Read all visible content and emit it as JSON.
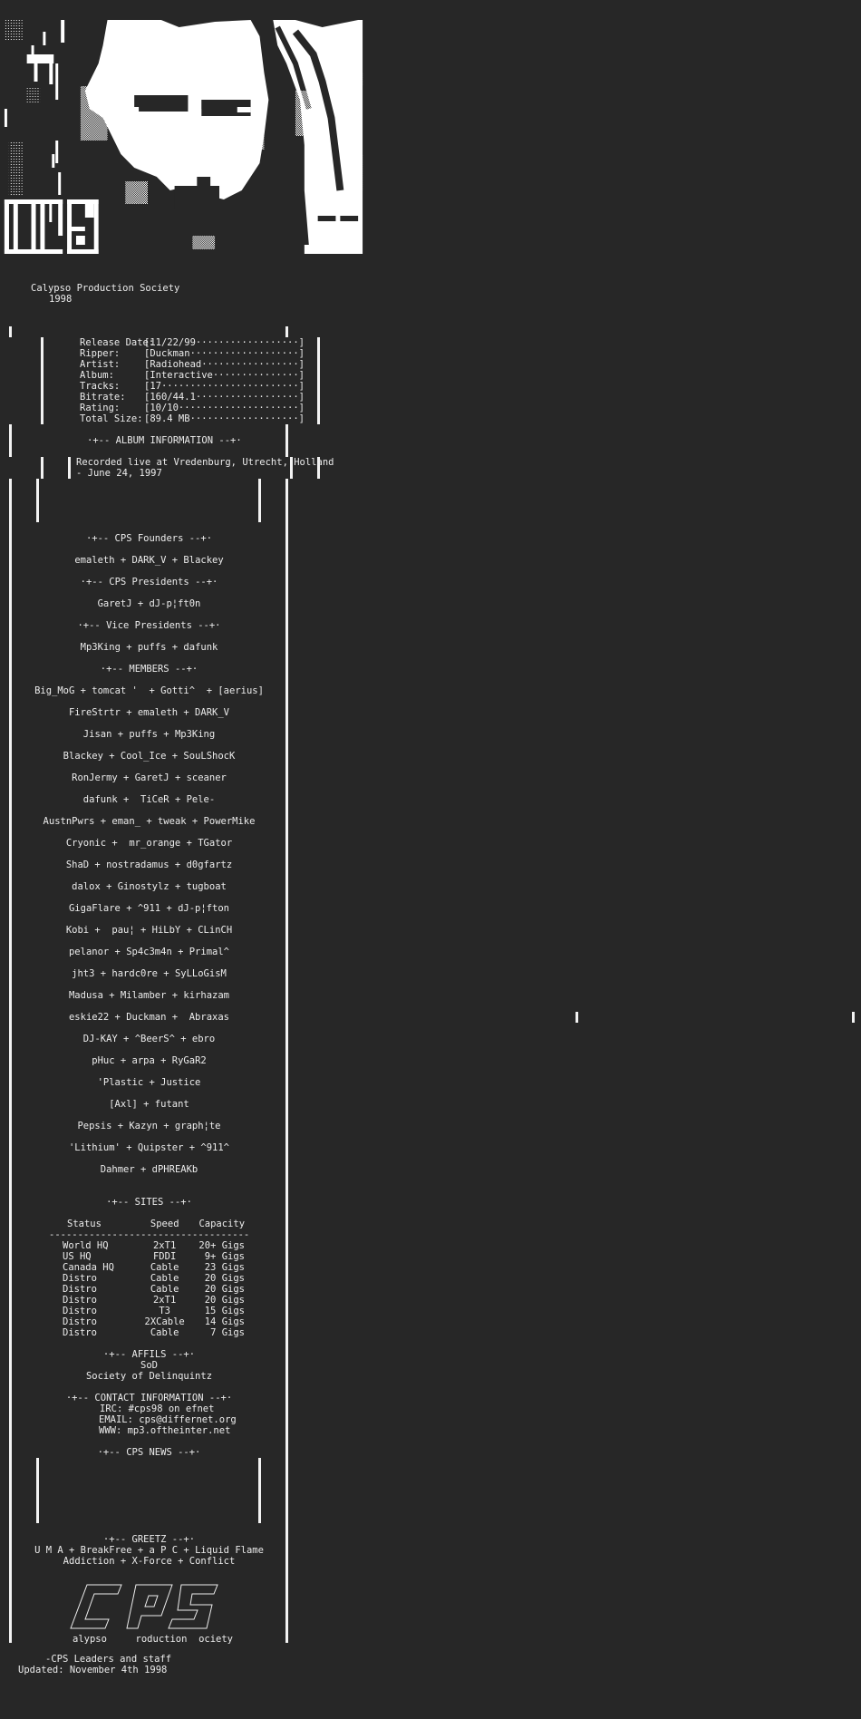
{
  "header": {
    "group_name": "Calypso Production Society",
    "year": "1998",
    "art_description": "ANSI/ASCII art portrait with CPS block logo"
  },
  "release": {
    "fields": [
      {
        "label": "Release Date:",
        "value": "[11/22/99··················]"
      },
      {
        "label": "Ripper:",
        "value": "[Duckman···················]"
      },
      {
        "label": "Artist:",
        "value": "[Radiohead·················]"
      },
      {
        "label": "Album:",
        "value": "[Interactive···············]"
      },
      {
        "label": "Tracks:",
        "value": "[17························]"
      },
      {
        "label": "Bitrate:",
        "value": "[160/44.1··················]"
      },
      {
        "label": "Rating:",
        "value": "[10/10·····················]"
      },
      {
        "label": "Total Size:",
        "value": "[89.4 MB···················]"
      }
    ]
  },
  "album_info": {
    "heading": "·+-- ALBUM INFORMATION --+·",
    "text_line1": "Recorded live at Vredenburg, Utrecht, Holland",
    "text_line2": "- June 24, 1997"
  },
  "founders": {
    "heading": "·+-- CPS Founders --+·",
    "names": "emaleth + DARK_V + Blackey"
  },
  "presidents": {
    "heading": "·+-- CPS Presidents --+·",
    "names": "GaretJ + dJ-p¦ft0n"
  },
  "vice_presidents": {
    "heading": "·+-- Vice Presidents --+·",
    "names": "Mp3King + puffs + dafunk"
  },
  "members": {
    "heading": "·+-- MEMBERS --+·",
    "lines": [
      "Big_MoG + tomcat '  + Gotti^  + [aerius]",
      "FireStrtr + emaleth + DARK_V",
      "Jisan + puffs + Mp3King",
      "Blackey + Cool_Ice + SouLShocK",
      "RonJermy + GaretJ + sceaner",
      "dafunk +  TiCeR + Pele-",
      "AustnPwrs + eman_ + tweak + PowerMike",
      "Cryonic +  mr_orange + TGator",
      "ShaD + nostradamus + d0gfartz",
      "dalox + Ginostylz + tugboat",
      "GigaFlare + ^911 + dJ-p¦fton",
      "Kobi +  pau¦ + HiLbY + CLinCH",
      "pelanor + Sp4c3m4n + Primal^",
      "jht3 + hardc0re + SyLLoGisM",
      "Madusa + Milamber + kirhazam",
      "eskie22 + Duckman +  Abraxas",
      "DJ-KAY + ^BeerS^ + ebro",
      "pHuc + arpa + RyGaR2",
      "'Plastic + Justice",
      "[Axl] + futant",
      "Pepsis + Kazyn + graph¦te",
      "'Lithium' + Quipster + ^911^",
      "Dahmer + dPHREAKb"
    ]
  },
  "sites": {
    "heading": "·+-- SITES --+·",
    "columns": [
      "Status",
      "Speed",
      "Capacity"
    ],
    "rule": "--------------------------------------------",
    "rows": [
      [
        "World HQ",
        "2xT1",
        "20+ Gigs"
      ],
      [
        "US HQ",
        "FDDI",
        "9+ Gigs"
      ],
      [
        "Canada HQ",
        "Cable",
        "23 Gigs"
      ],
      [
        "Distro",
        "Cable",
        "20 Gigs"
      ],
      [
        "Distro",
        "Cable",
        "20 Gigs"
      ],
      [
        "Distro",
        "2xT1",
        "20 Gigs"
      ],
      [
        "Distro",
        "T3",
        "15 Gigs"
      ],
      [
        "Distro",
        "2XCable",
        "14 Gigs"
      ],
      [
        "Distro",
        "Cable",
        "7 Gigs"
      ]
    ]
  },
  "affils": {
    "heading": "·+-- AFFILS --+·",
    "short": "SoD",
    "full": "Society of Delinquintz"
  },
  "contact": {
    "heading": "·+-- CONTACT INFORMATION --+·",
    "irc": "IRC: #cps98 on efnet",
    "email": "EMAIL: cps@differnet.org",
    "www": "WWW: mp3.oftheinter.net"
  },
  "news": {
    "heading": "·+-- CPS NEWS --+·"
  },
  "greetz": {
    "heading": "·+-- GREETZ --+·",
    "line1": "U M A + BreakFree + a P C + Liquid Flame",
    "line2": "Addiction + X-Force + Conflict"
  },
  "logo": {
    "letters": "CPS",
    "caption": "alypso     roduction  ociety"
  },
  "footer": {
    "signature": "-CPS Leaders and staff",
    "updated": "Updated: November 4th 1998"
  }
}
